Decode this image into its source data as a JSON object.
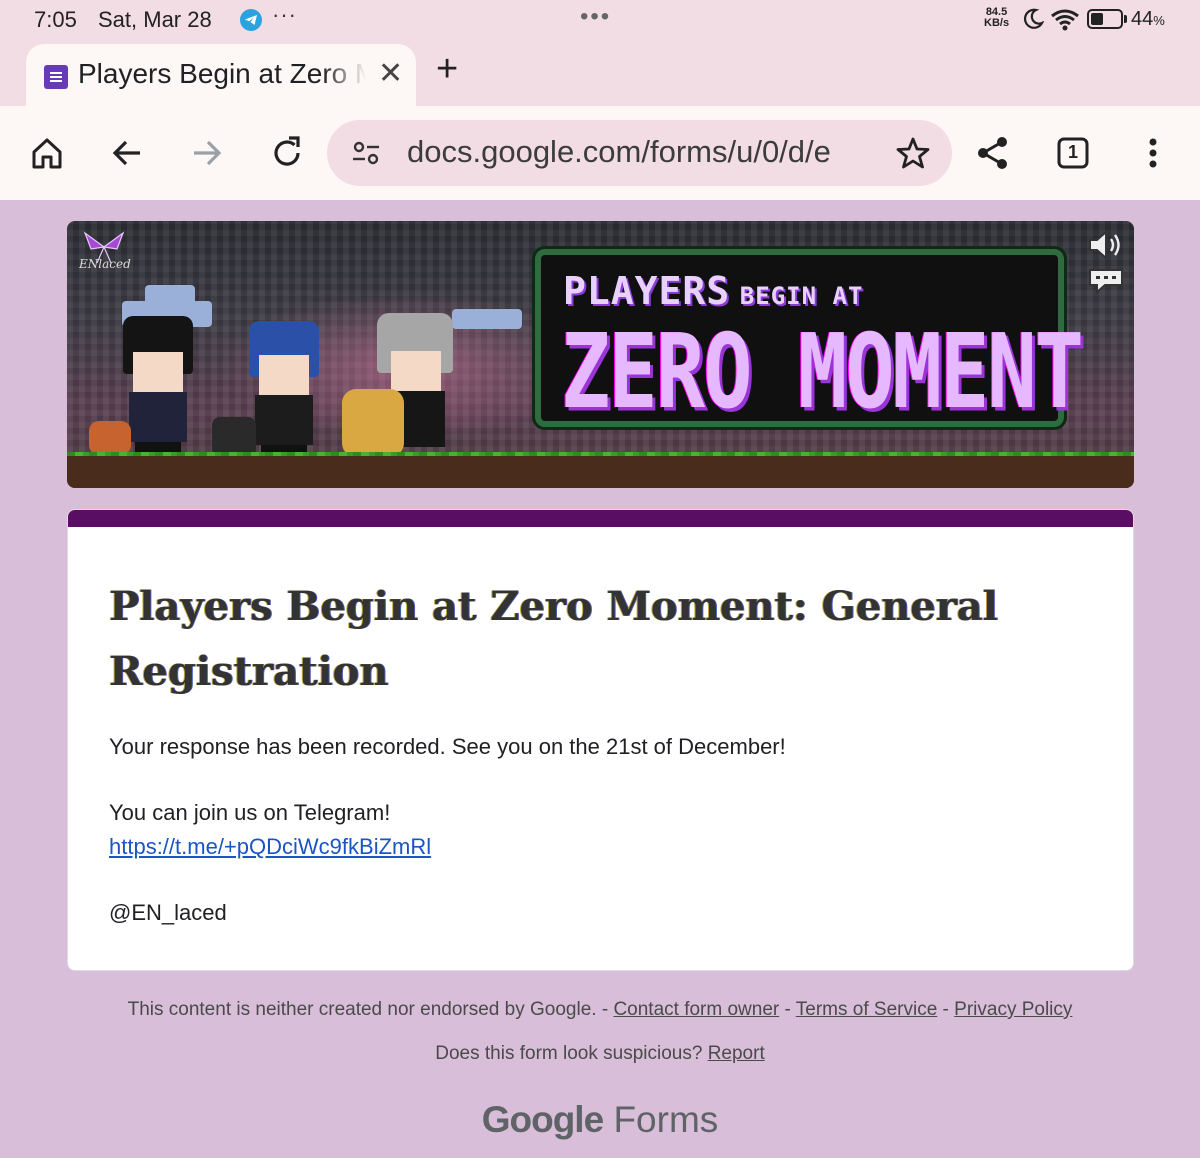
{
  "status_bar": {
    "time": "7:05",
    "date": "Sat, Mar 28",
    "notification_icon": "telegram-icon",
    "overflow": "···",
    "center_dots": "•••",
    "network_speed_value": "84.5",
    "network_speed_unit": "KB/s",
    "battery_percent": "44",
    "battery_percent_symbol": "%",
    "battery_level": 0.44
  },
  "tabs": [
    {
      "title": "Players Begin at Zero Moment: General Registration",
      "favicon": "google-forms-icon"
    }
  ],
  "tab_close": "✕",
  "new_tab": "+",
  "toolbar": {
    "url": "docs.google.com/forms/u/0/d/e",
    "tab_count": "1"
  },
  "banner": {
    "title_line1": "PLAYERS",
    "title_line1_small": "BEGIN AT",
    "title_line2": "ZERO MOMENT",
    "logo_text": "ENlaced"
  },
  "form": {
    "title": "Players Begin at Zero Moment: General Registration",
    "confirmation": "Your response has been recorded. See you on the 21st of December!",
    "telegram_line": "You can join us on Telegram!",
    "telegram_link": "https://t.me/+pQDciWc9fkBiZmRl",
    "handle": "@EN_laced"
  },
  "footer": {
    "disclaimer": "This content is neither created nor endorsed by Google.",
    "sep": " - ",
    "contact": "Contact form owner",
    "terms": "Terms of Service",
    "privacy": "Privacy Policy",
    "suspicious": "Does this form look suspicious?",
    "report": "Report",
    "brand_google": "Google",
    "brand_forms": "Forms"
  },
  "colors": {
    "page_bg": "#d8bed8",
    "accent": "#5a0e63",
    "link": "#1a55c4"
  }
}
